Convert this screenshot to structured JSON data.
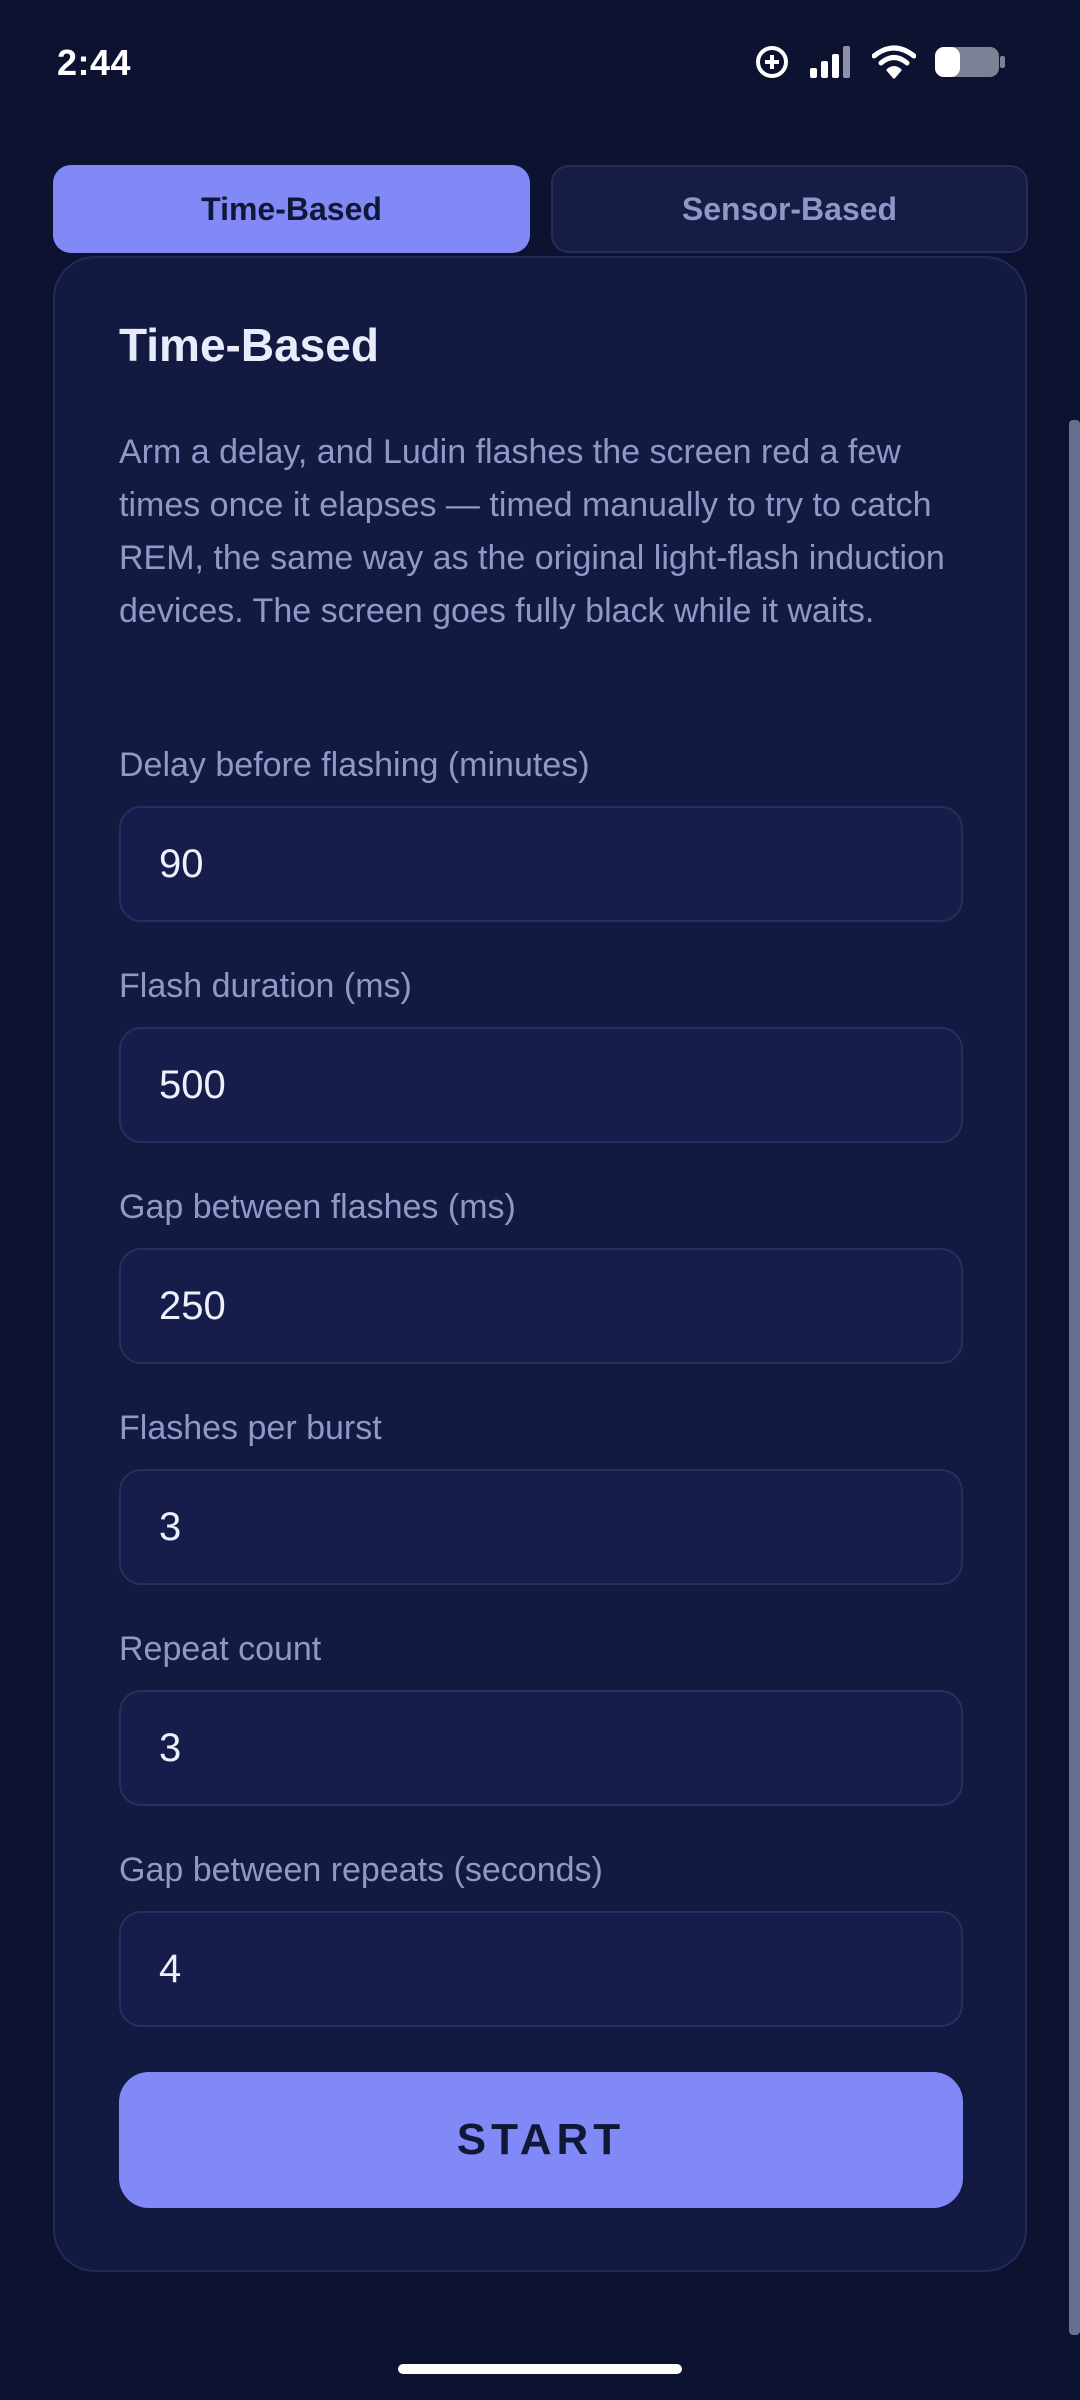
{
  "status_bar": {
    "time": "2:44",
    "icons": [
      "data-saver-icon",
      "signal-icon",
      "wifi-icon",
      "battery-icon"
    ]
  },
  "tabs": [
    {
      "label": "Time-Based",
      "active": true
    },
    {
      "label": "Sensor-Based",
      "active": false
    }
  ],
  "card": {
    "title": "Time-Based",
    "description": "Arm a delay, and Ludin flashes the screen red a few times once it elapses — timed manually to try to catch REM, the same way as the original light-flash induction devices. The screen goes fully black while it waits."
  },
  "fields": [
    {
      "label": "Delay before flashing (minutes)",
      "value": "90"
    },
    {
      "label": "Flash duration (ms)",
      "value": "500"
    },
    {
      "label": "Gap between flashes (ms)",
      "value": "250"
    },
    {
      "label": "Flashes per burst",
      "value": "3"
    },
    {
      "label": "Repeat count",
      "value": "3"
    },
    {
      "label": "Gap between repeats (seconds)",
      "value": "4"
    }
  ],
  "actions": {
    "start_label": "START"
  },
  "colors": {
    "background": "#0c1230",
    "card": "#131a42",
    "accent": "#8189f7",
    "muted_text": "#8f98c6"
  }
}
